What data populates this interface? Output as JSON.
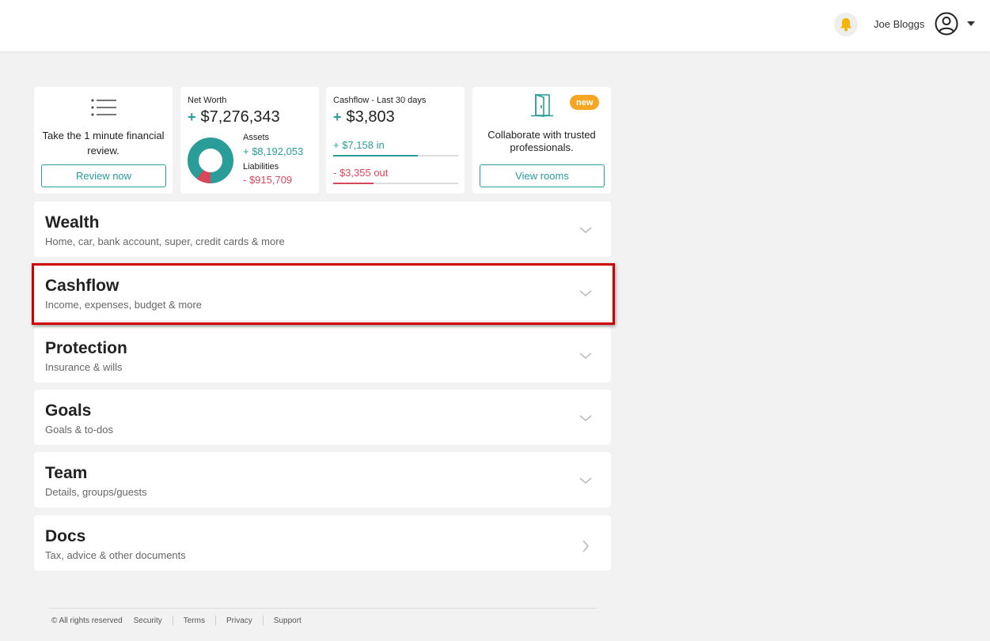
{
  "header": {
    "user_name": "Joe Bloggs",
    "icons": {
      "notification": "bell-icon",
      "profile": "user-circle-icon",
      "menu": "caret-down-icon"
    },
    "bell_color": "#f5b400"
  },
  "cards": {
    "review": {
      "icon": "list-icon",
      "text": "Take the 1 minute financial review.",
      "button": "Review now"
    },
    "net_worth": {
      "label": "Net Worth",
      "sign": "+",
      "value": "$7,276,343",
      "assets_label": "Assets",
      "assets_value": "+ $8,192,053",
      "liabilities_label": "Liabilities",
      "liabilities_value": "- $915,709",
      "liabilities_fraction": 0.101
    },
    "cashflow": {
      "label": "Cashflow - Last 30 days",
      "sign": "+",
      "value": "$3,803",
      "in_value": "+ $7,158",
      "in_word": "in",
      "in_fraction": 0.68,
      "out_value": "- $3,355",
      "out_word": "out",
      "out_fraction": 0.32
    },
    "rooms": {
      "icon": "door-icon",
      "badge": "new",
      "text": "Collaborate with trusted professionals.",
      "button": "View rooms"
    }
  },
  "sections": [
    {
      "title": "Wealth",
      "subtitle": "Home, car, bank account, super, credit cards & more",
      "icon": "chevron-down-icon"
    },
    {
      "title": "Cashflow",
      "subtitle": "Income, expenses, budget & more",
      "icon": "chevron-down-icon"
    },
    {
      "title": "Protection",
      "subtitle": "Insurance & wills",
      "icon": "chevron-down-icon"
    },
    {
      "title": "Goals",
      "subtitle": "Goals & to-dos",
      "icon": "chevron-down-icon"
    },
    {
      "title": "Team",
      "subtitle": "Details, groups/guests",
      "icon": "chevron-down-icon"
    },
    {
      "title": "Docs",
      "subtitle": "Tax, advice & other documents",
      "icon": "chevron-right-icon"
    }
  ],
  "footer": {
    "copyright": "© All rights reserved",
    "links": [
      "Security",
      "Terms",
      "Privacy",
      "Support"
    ]
  },
  "colors": {
    "teal": "#2a9d98",
    "red": "#d9475b",
    "badge": "#f5a623",
    "highlight": "#d00000"
  }
}
